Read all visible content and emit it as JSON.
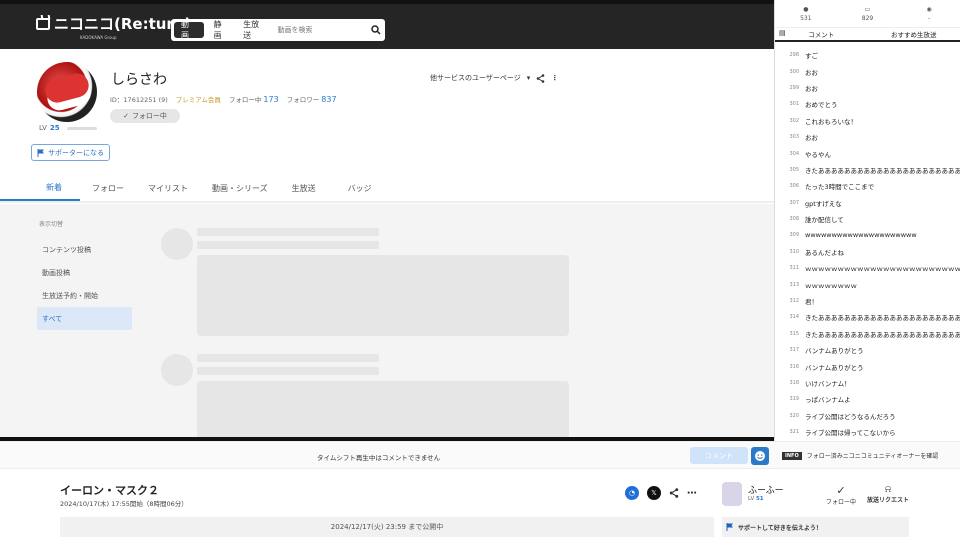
{
  "header": {
    "logo_text": "ニコニコ(Re:turn)",
    "logo_sub": "KADOKAWA Group",
    "search_tabs": [
      "動画",
      "静画",
      "生放送"
    ],
    "search_placeholder": "動画を検索"
  },
  "profile": {
    "name": "しらさわ",
    "id_label": "ID：17612251 (9)",
    "premium_label": "プレミアム会員",
    "following_label": "フォロー中",
    "following_count": "173",
    "followers_label": "フォロワー",
    "followers_count": "837",
    "follow_button": "フォロー中",
    "lv_label": "LV",
    "lv_value": "25",
    "supporter_button": "サポーターになる",
    "other_services": "他サービスのユーザーページ"
  },
  "tabs": [
    "新着",
    "フォロー",
    "マイリスト",
    "動画・シリーズ",
    "生放送",
    "バッジ"
  ],
  "side_menu": {
    "title": "表示切替",
    "items": [
      "コンテンツ投稿",
      "動画投稿",
      "生放送予約・開始",
      "すべて"
    ]
  },
  "comment_bar": {
    "notice": "タイムシフト再生中はコメントできません",
    "submit": "コメント",
    "info_tag": "INFO",
    "info_text": "フォロー済みニコニコミュニティオーナーを確認"
  },
  "stream": {
    "title": "イーロン・マスク２",
    "date": "2024/10/17(木) 17:55開始（8時間06分）",
    "public_until": "2024/12/17(火) 23:59 まで公開中",
    "broadcaster_name": "ふーふー",
    "broadcaster_lv_label": "LV",
    "broadcaster_lv": "51",
    "follow_label": "フォロー中",
    "request_label": "放送リクエスト",
    "support_text": "サポートして好きを伝えよう！"
  },
  "chat": {
    "stats": [
      "531",
      "829",
      "-"
    ],
    "tabs": [
      "コメント",
      "おすすめ生放送"
    ],
    "comments": [
      {
        "no": "298",
        "text": "すご"
      },
      {
        "no": "300",
        "text": "おお"
      },
      {
        "no": "299",
        "text": "おお"
      },
      {
        "no": "301",
        "text": "おめでとう"
      },
      {
        "no": "302",
        "text": "これおもろいな！"
      },
      {
        "no": "303",
        "text": "おお"
      },
      {
        "no": "304",
        "text": "やるやん"
      },
      {
        "no": "305",
        "text": "きたああああああああああああああああああああああああああああ"
      },
      {
        "no": "306",
        "text": "たった3時間でここまで"
      },
      {
        "no": "307",
        "text": "gptすげえな"
      },
      {
        "no": "308",
        "text": "誰か配信して"
      },
      {
        "no": "309",
        "text": "wwwwwwwwwwwwwwwwwwwww"
      },
      {
        "no": "310",
        "text": "あるんだよね"
      },
      {
        "no": "311",
        "text": "ｗｗｗｗｗｗｗｗｗｗｗｗｗｗｗｗｗｗｗｗｗｗｗｗｗｗｗ"
      },
      {
        "no": "313",
        "text": "ｗｗｗｗｗｗｗｗ"
      },
      {
        "no": "312",
        "text": "君！"
      },
      {
        "no": "314",
        "text": "きたあああああああああああああああああああああああああああああ"
      },
      {
        "no": "315",
        "text": "きたあああああああああああああああああああああああああ"
      },
      {
        "no": "317",
        "text": "バンナムありがとう"
      },
      {
        "no": "316",
        "text": "バンナムありがとう"
      },
      {
        "no": "318",
        "text": "いけバンナム！"
      },
      {
        "no": "319",
        "text": "っぱバンナムよ"
      },
      {
        "no": "320",
        "text": "ライブ公開はどうなるんだろう"
      },
      {
        "no": "321",
        "text": "ライブ公開は帰ってこないから"
      }
    ]
  },
  "colors": {
    "accent": "#2a7ac9",
    "header_bg": "#252525",
    "premium": "#c79a2a"
  }
}
